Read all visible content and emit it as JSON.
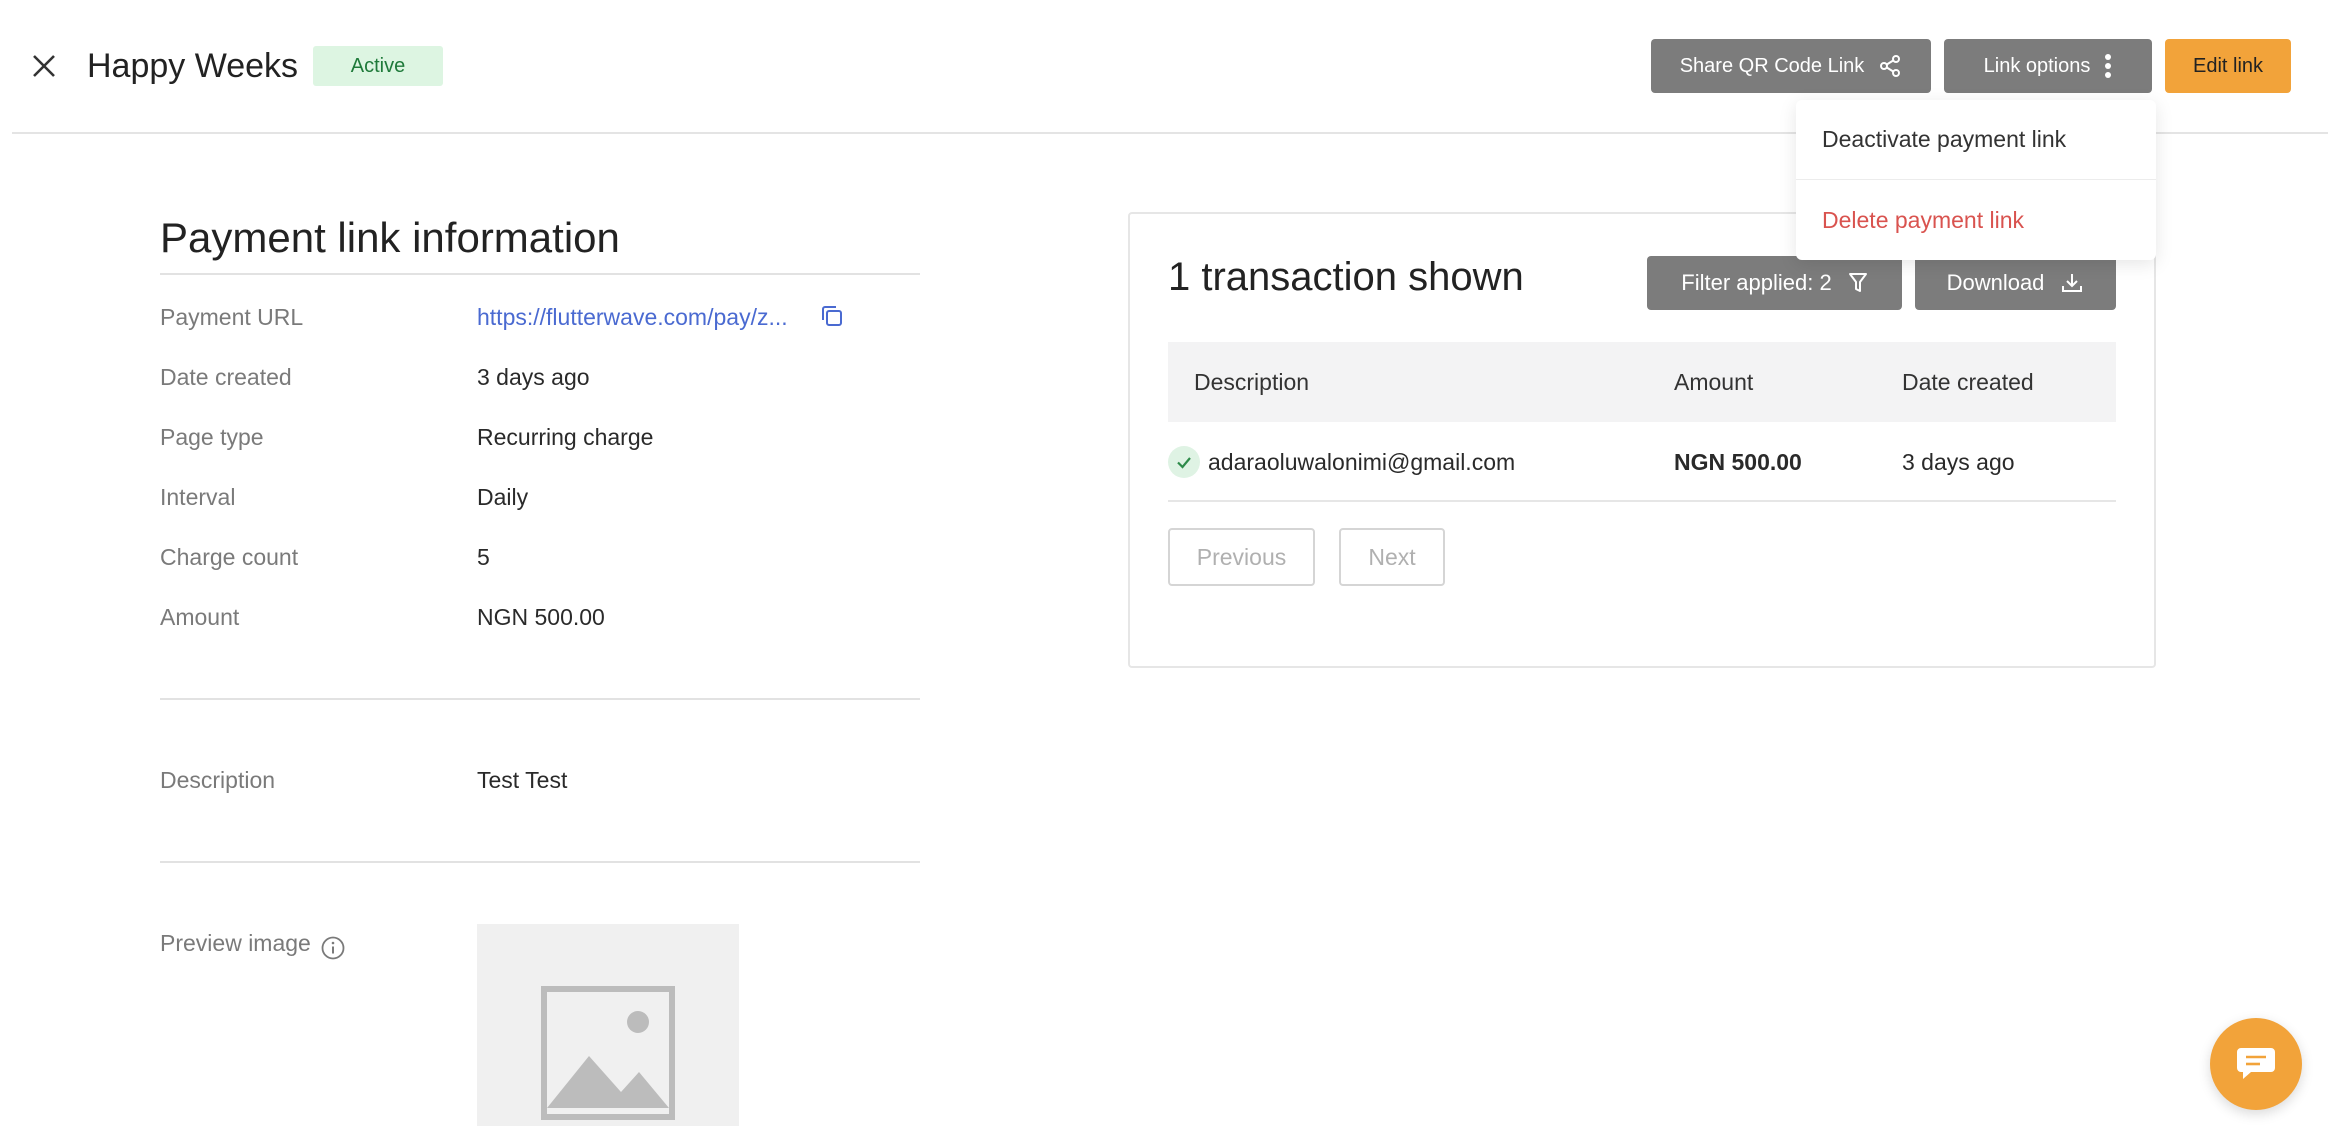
{
  "header": {
    "title": "Happy Weeks",
    "status": "Active",
    "share_label": "Share QR Code Link",
    "options_label": "Link options",
    "edit_label": "Edit link"
  },
  "link_options_menu": {
    "items": [
      "Deactivate payment link",
      "Delete payment link"
    ]
  },
  "info": {
    "title": "Payment link information",
    "rows": [
      {
        "label": "Payment URL",
        "value": "https://flutterwave.com/pay/z..."
      },
      {
        "label": "Date created",
        "value": "3 days ago"
      },
      {
        "label": "Page type",
        "value": "Recurring charge"
      },
      {
        "label": "Interval",
        "value": "Daily"
      },
      {
        "label": "Charge count",
        "value": "5"
      },
      {
        "label": "Amount",
        "value": "NGN 500.00"
      }
    ],
    "description": {
      "label": "Description",
      "value": "Test Test"
    },
    "preview_label": "Preview image"
  },
  "transactions": {
    "title": "1 transaction shown",
    "filter_label": "Filter applied: 2",
    "download_label": "Download",
    "columns": [
      "Description",
      "Amount",
      "Date created"
    ],
    "rows": [
      {
        "description": "adaraoluwalonimi@gmail.com",
        "amount": "NGN 500.00",
        "date": "3 days ago",
        "status": "success"
      }
    ],
    "prev_label": "Previous",
    "next_label": "Next"
  },
  "colors": {
    "accent": "#f2a33a",
    "button_gray": "#7c7c7c",
    "link": "#4a6ad1",
    "danger": "#d9534f",
    "active_badge_bg": "#ddf5e2"
  }
}
